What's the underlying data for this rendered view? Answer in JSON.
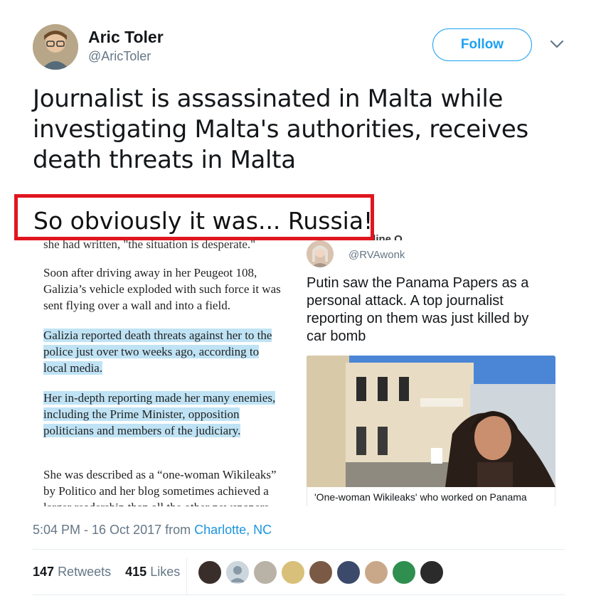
{
  "author": {
    "name": "Aric Toler",
    "handle": "@AricToler"
  },
  "follow_label": "Follow",
  "tweet": {
    "line1": "Journalist is assassinated in Malta while",
    "line2": "investigating Malta's authorities, receives",
    "line3": "death threats in Malta"
  },
  "overlay_caption": "So obviously it was... Russia!",
  "article": {
    "frag_top": "she had written, \"the situation is desperate.\"",
    "p1": "Soon after driving away in her Peugeot 108, Galizia’s vehicle exploded with such force it was sent flying over a wall and into a field.",
    "p2": "Galizia reported death threats against her to the police just over two weeks ago, according to local media.",
    "p3": "Her in-depth reporting made her many enemies, including the Prime Minister, opposition politicians and members of the judiciary.",
    "p4": "She was described as a “one-woman Wikileaks” by Politico and her blog sometimes achieved a larger readership than all the other newspapers"
  },
  "embedded_card": {
    "name_fragment": "Caroline O.",
    "handle": "@RVAwonk",
    "text": "Putin saw the Panama Papers as a personal attack. A top journalist reporting on them was just killed by car bomb",
    "caption": "'One-woman Wikileaks' who worked on Panama"
  },
  "timestamp": {
    "time": "5:04 PM - 16 Oct 2017 from ",
    "place": "Charlotte, NC"
  },
  "stats": {
    "retweets_count": "147",
    "retweets_label": "Retweets",
    "likes_count": "415",
    "likes_label": "Likes"
  },
  "colors": {
    "accent": "#1da1f2",
    "highlight": "#bfe3f5",
    "redbox": "#e0161f"
  }
}
